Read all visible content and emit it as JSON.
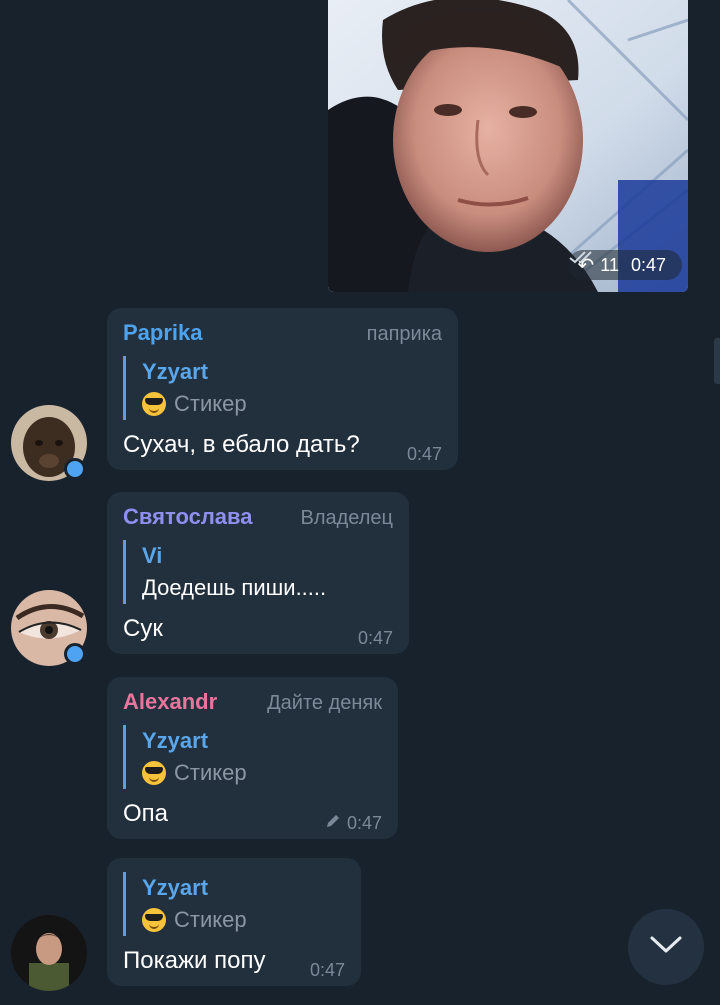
{
  "photo_message": {
    "reply_count": "11",
    "time": "0:47"
  },
  "messages": [
    {
      "author": "Paprika",
      "author_color": "#4ea3ee",
      "role": "паприка",
      "quote_author": "Yzyart",
      "quote_text": "Стикер",
      "quote_icon": "sunglasses-emoji-icon",
      "text": "Сухач, в ебало дать?",
      "time": "0:47"
    },
    {
      "author": "Святослава",
      "author_color": "#8f8ff0",
      "role": "Владелец",
      "quote_author": "Vi",
      "quote_text": "Доедешь пиши.....",
      "text": "Сук",
      "time": "0:47"
    },
    {
      "author": "Alexandr",
      "author_color": "#e8759c",
      "role": "Дайте деняк",
      "quote_author": "Yzyart",
      "quote_text": "Стикер",
      "quote_icon": "sunglasses-emoji-icon",
      "text": "Опа",
      "time": "0:47",
      "edited_icon": "pencil-icon"
    },
    {
      "quote_author": "Yzyart",
      "quote_text": "Стикер",
      "quote_icon": "sunglasses-emoji-icon",
      "text": "Покажи попу",
      "time": "0:47"
    }
  ],
  "scroll_down_icon": "chevron-down-icon"
}
